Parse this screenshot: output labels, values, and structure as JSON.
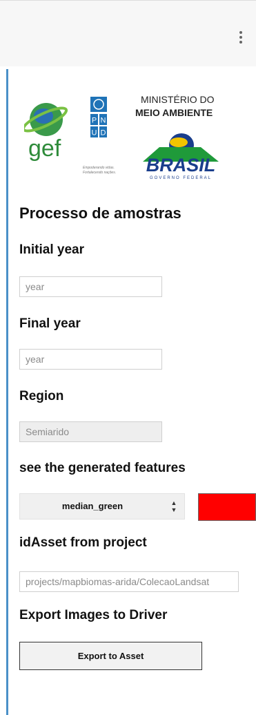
{
  "toolbar": {
    "menu_icon": "more-vert-icon"
  },
  "logos": {
    "gef_text": "gef",
    "pnud_letters": [
      "P",
      "N",
      "U",
      "D"
    ],
    "pnud_tagline_1": "Empoderando vidas.",
    "pnud_tagline_2": "Fortalecendo nações.",
    "ministry_line1": "MINISTÉRIO DO",
    "ministry_line2": "MEIO AMBIENTE",
    "brasil_text": "BRASIL",
    "governo_text": "GOVERNO FEDERAL"
  },
  "panel": {
    "title": "Processo de amostras",
    "initial_year": {
      "label": "Initial year",
      "placeholder": "year"
    },
    "final_year": {
      "label": "Final year",
      "placeholder": "year"
    },
    "region": {
      "label": "Region",
      "placeholder": "Semiarido"
    },
    "features": {
      "label": "see the generated features",
      "selected": "median_green",
      "color": "#ff0000"
    },
    "id_asset": {
      "label": "idAsset from project",
      "placeholder": "projects/mapbiomas-arida/ColecaoLandsat"
    },
    "export": {
      "label": "Export Images to Driver",
      "button": "Export to Asset"
    }
  },
  "colors": {
    "accent_border": "#4a90c8",
    "gef_green": "#2e8b3a",
    "undp_blue": "#1f73b7",
    "brasil_blue": "#1a3e8c",
    "brasil_green": "#1f9a3a"
  }
}
